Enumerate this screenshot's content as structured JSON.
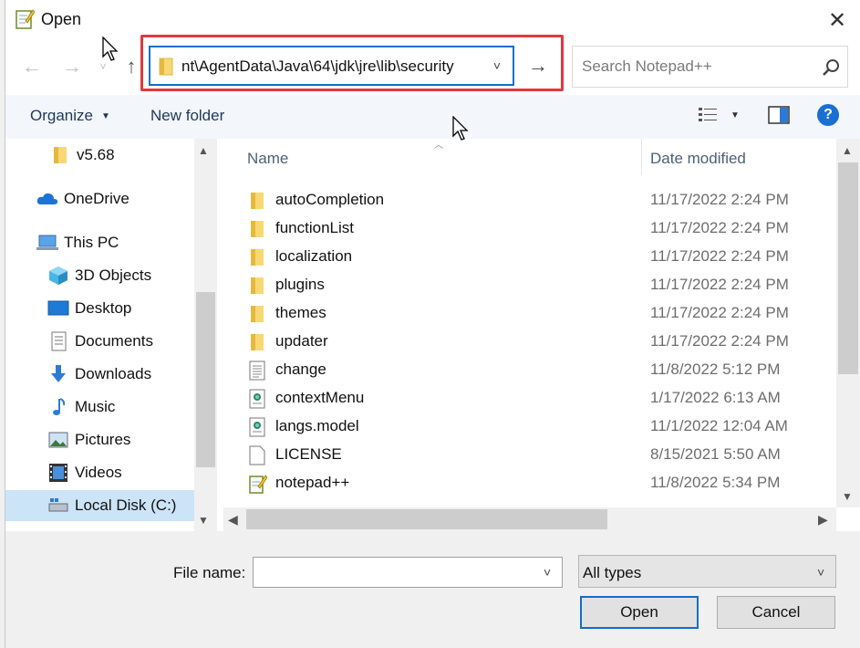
{
  "window": {
    "title": "Open",
    "close_glyph": "✕"
  },
  "nav": {
    "back_glyph": "←",
    "forward_glyph": "→",
    "recent_glyph": "˅",
    "up_glyph": "↑",
    "go_glyph": "→"
  },
  "address": {
    "path": "nt\\AgentData\\Java\\64\\jdk\\jre\\lib\\security",
    "dropdown_glyph": "˅"
  },
  "search": {
    "placeholder": "Search Notepad++"
  },
  "toolbar": {
    "organize_label": "Organize",
    "new_folder_label": "New folder",
    "help_label": "?",
    "caret_glyph": "▼"
  },
  "sidebar": {
    "items": [
      {
        "label": "v5.68",
        "icon": "folder-icon"
      },
      {
        "label": "OneDrive",
        "icon": "cloud-icon"
      },
      {
        "label": "This PC",
        "icon": "computer-icon"
      },
      {
        "label": "3D Objects",
        "icon": "cube-icon"
      },
      {
        "label": "Desktop",
        "icon": "desktop-icon"
      },
      {
        "label": "Documents",
        "icon": "documents-icon"
      },
      {
        "label": "Downloads",
        "icon": "download-arrow-icon"
      },
      {
        "label": "Music",
        "icon": "music-note-icon"
      },
      {
        "label": "Pictures",
        "icon": "pictures-icon"
      },
      {
        "label": "Videos",
        "icon": "film-icon"
      },
      {
        "label": "Local Disk (C:)",
        "icon": "drive-icon"
      }
    ]
  },
  "file_list": {
    "columns": {
      "name": "Name",
      "date": "Date modified"
    },
    "rows": [
      {
        "name": "autoCompletion",
        "date": "11/17/2022 2:24 PM",
        "icon": "folder-icon"
      },
      {
        "name": "functionList",
        "date": "11/17/2022 2:24 PM",
        "icon": "folder-icon"
      },
      {
        "name": "localization",
        "date": "11/17/2022 2:24 PM",
        "icon": "folder-icon"
      },
      {
        "name": "plugins",
        "date": "11/17/2022 2:24 PM",
        "icon": "folder-icon"
      },
      {
        "name": "themes",
        "date": "11/17/2022 2:24 PM",
        "icon": "folder-icon"
      },
      {
        "name": "updater",
        "date": "11/17/2022 2:24 PM",
        "icon": "folder-icon"
      },
      {
        "name": "change",
        "date": "11/8/2022 5:12 PM",
        "icon": "text-file-icon"
      },
      {
        "name": "contextMenu",
        "date": "1/17/2022 6:13 AM",
        "icon": "xml-file-icon"
      },
      {
        "name": "langs.model",
        "date": "11/1/2022 12:04 AM",
        "icon": "xml-file-icon"
      },
      {
        "name": "LICENSE",
        "date": "8/15/2021 5:50 AM",
        "icon": "blank-file-icon"
      },
      {
        "name": "notepad++",
        "date": "11/8/2022 5:34 PM",
        "icon": "notepad-app-icon"
      }
    ]
  },
  "bottom": {
    "file_name_label": "File name:",
    "file_name_value": "",
    "file_type": "All types",
    "open_label": "Open",
    "cancel_label": "Cancel",
    "dropdown_glyph": "˅"
  },
  "colors": {
    "accent": "#0e6fc7",
    "highlight_box": "#e0393e",
    "toolbar_bg": "#f3f6fb",
    "selected_bg": "#cce4f7",
    "folder_yellow": "#f8d775"
  }
}
